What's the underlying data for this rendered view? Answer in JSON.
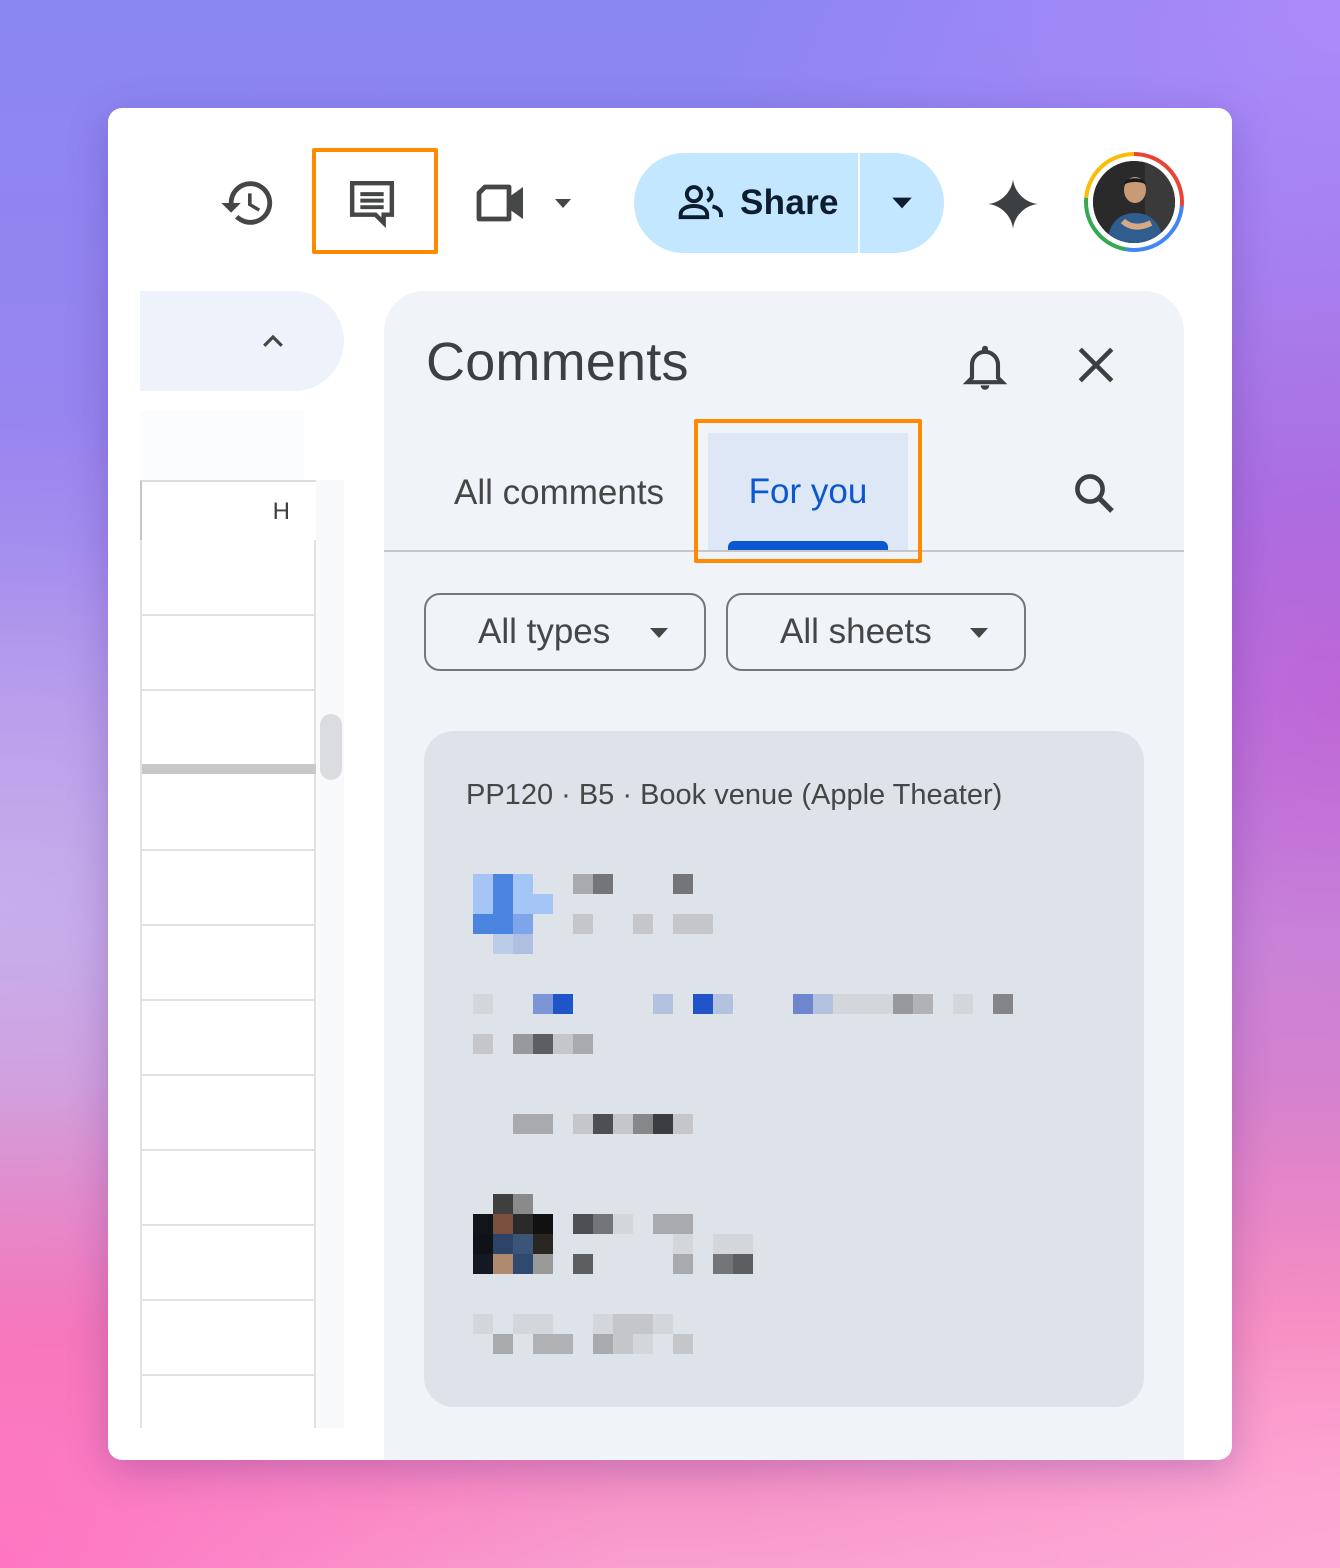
{
  "toolbar": {
    "share_label": "Share",
    "icons": [
      "history-icon",
      "comments-icon",
      "meet-video-icon",
      "share-people-icon",
      "gemini-spark-icon"
    ],
    "accent_share_bg": "#c2e7ff",
    "highlight_color": "#ff8a00"
  },
  "sheet": {
    "column_header": "H"
  },
  "comments": {
    "title": "Comments",
    "tabs": [
      {
        "label": "All comments",
        "selected": false
      },
      {
        "label": "For you",
        "selected": true
      }
    ],
    "filters": {
      "types": "All types",
      "sheets": "All sheets"
    },
    "thread": {
      "context": "PP120 · B5 · Book venue (Apple Theater)"
    },
    "accent": "#0b57d0"
  }
}
